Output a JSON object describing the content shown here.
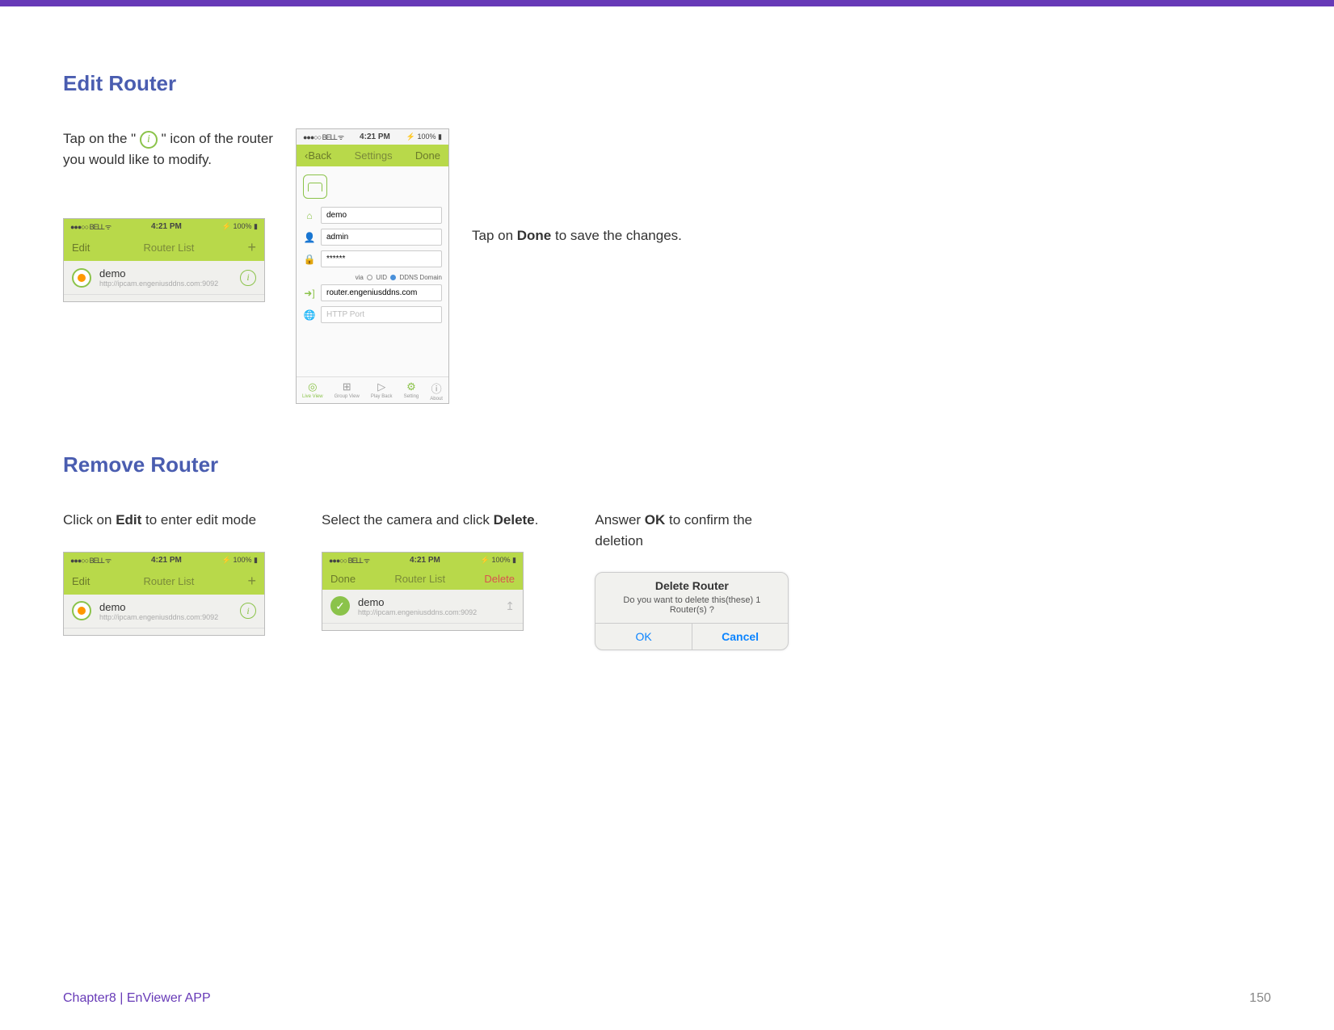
{
  "sections": {
    "edit": {
      "heading": "Edit Router",
      "instr_pre": "Tap on the \" ",
      "instr_post": " \"  icon of the router you would like to modify.",
      "done_instr_pre": "Tap on ",
      "done_instr_bold": "Done",
      "done_instr_post": " to save the changes."
    },
    "remove": {
      "heading": "Remove Router",
      "step1_pre": "Click on ",
      "step1_bold": "Edit",
      "step1_post": " to enter edit mode",
      "step2_pre": "Select the camera and click ",
      "step2_bold": "Delete",
      "step2_post": ".",
      "step3_pre": "Answer ",
      "step3_bold": "OK",
      "step3_post": " to confirm the deletion"
    }
  },
  "phone_list": {
    "status_carrier": "●●●○○ BELL",
    "status_time": "4:21 PM",
    "status_batt": "100%",
    "nav_left_edit": "Edit",
    "nav_left_done": "Done",
    "nav_title": "Router List",
    "nav_right_plus": "+",
    "nav_right_delete": "Delete",
    "item_title": "demo",
    "item_sub": "http://ipcam.engeniusddns.com:9092"
  },
  "phone_settings": {
    "status_carrier": "●●●○○ BELL",
    "status_time": "4:21 PM",
    "status_batt": "100%",
    "nav_back": "Back",
    "nav_title": "Settings",
    "nav_done": "Done",
    "field_name": "demo",
    "field_user": "admin",
    "field_pass": "******",
    "via_label": "via",
    "via_uid": "UID",
    "via_ddns": "DDNS Domain",
    "field_domain": "router.engeniusddns.com",
    "field_port_ph": "HTTP Port",
    "tabs": {
      "live": "Live View",
      "group": "Group View",
      "play": "Play Back",
      "setting": "Setting",
      "about": "About"
    }
  },
  "dialog": {
    "title_pre": "Delete ",
    "title_bold": "Router",
    "msg": "Do you want to delete this(these) 1 Router(s) ?",
    "ok": "OK",
    "cancel": "Cancel"
  },
  "footer": {
    "chapter": "Chapter8  |  EnViewer APP",
    "page": "150"
  },
  "icons": {
    "info": "i",
    "wifi": "ᯤ",
    "check": "✓",
    "share": "↥",
    "chevron_left": "‹"
  }
}
